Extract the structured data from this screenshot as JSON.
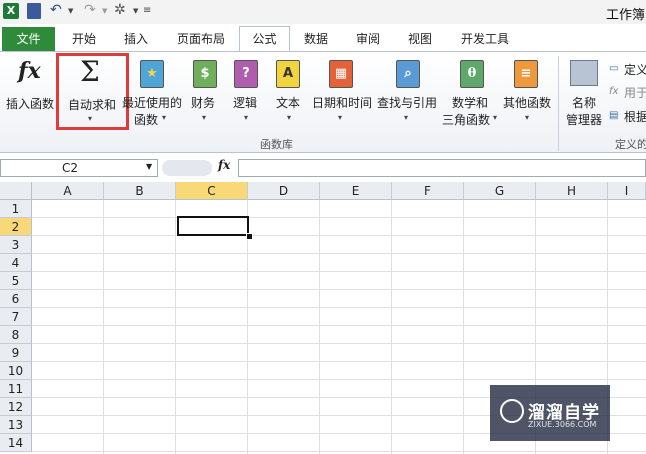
{
  "window": {
    "title": "工作簿"
  },
  "tabs": [
    "文件",
    "开始",
    "插入",
    "页面布局",
    "公式",
    "数据",
    "审阅",
    "视图",
    "开发工具"
  ],
  "active_tab": "公式",
  "ribbon": {
    "insert_function": "插入函数",
    "autosum": "自动求和",
    "recent_line1": "最近使用的",
    "recent_line2": "函数",
    "financial": "财务",
    "logical": "逻辑",
    "text": "文本",
    "datetime": "日期和时间",
    "lookup": "查找与引用",
    "math_line1": "数学和",
    "math_line2": "三角函数",
    "more": "其他函数",
    "name_mgr_line1": "名称",
    "name_mgr_line2": "管理器",
    "define_name": "定义",
    "use_in_formula": "用于",
    "create_from_sel": "根据",
    "group_function_library": "函数库",
    "group_defined_names": "定义的"
  },
  "formula_bar": {
    "name_box": "C2",
    "fx_label": "fx",
    "formula": ""
  },
  "grid": {
    "columns": [
      "A",
      "B",
      "C",
      "D",
      "E",
      "F",
      "G",
      "H",
      "I"
    ],
    "rows": [
      "1",
      "2",
      "3",
      "4",
      "5",
      "6",
      "7",
      "8",
      "9",
      "10",
      "11",
      "12",
      "13",
      "14"
    ],
    "selected_column": "C",
    "selected_row": "2"
  },
  "watermark": {
    "brand": "溜溜自学",
    "url": "ZIXUE.3066.COM"
  },
  "colors": {
    "file_tab": "#2f8b39",
    "highlight_box": "#e03a3a",
    "selected_header": "#f8d877"
  }
}
